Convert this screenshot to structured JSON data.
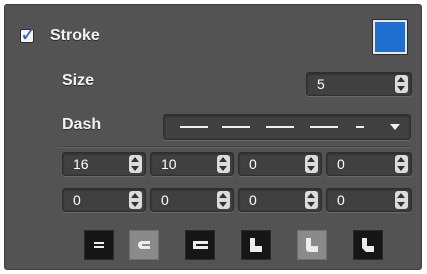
{
  "stroke": {
    "enabled": true,
    "label": "Stroke",
    "color": "#1e6fce"
  },
  "size": {
    "label": "Size",
    "value": "5"
  },
  "dash": {
    "label": "Dash",
    "pattern": "long-dashes"
  },
  "dash_gap_fields": {
    "row1": [
      "16",
      "10",
      "0",
      "0"
    ],
    "row2": [
      "0",
      "0",
      "0",
      "0"
    ]
  },
  "cap_join_buttons": [
    {
      "name": "butt-cap-icon",
      "active": false
    },
    {
      "name": "round-cap-icon",
      "active": true
    },
    {
      "name": "square-cap-icon",
      "active": false
    },
    {
      "name": "miter-join-icon",
      "active": false
    },
    {
      "name": "round-join-icon",
      "active": true
    },
    {
      "name": "bevel-join-icon",
      "active": false
    }
  ]
}
